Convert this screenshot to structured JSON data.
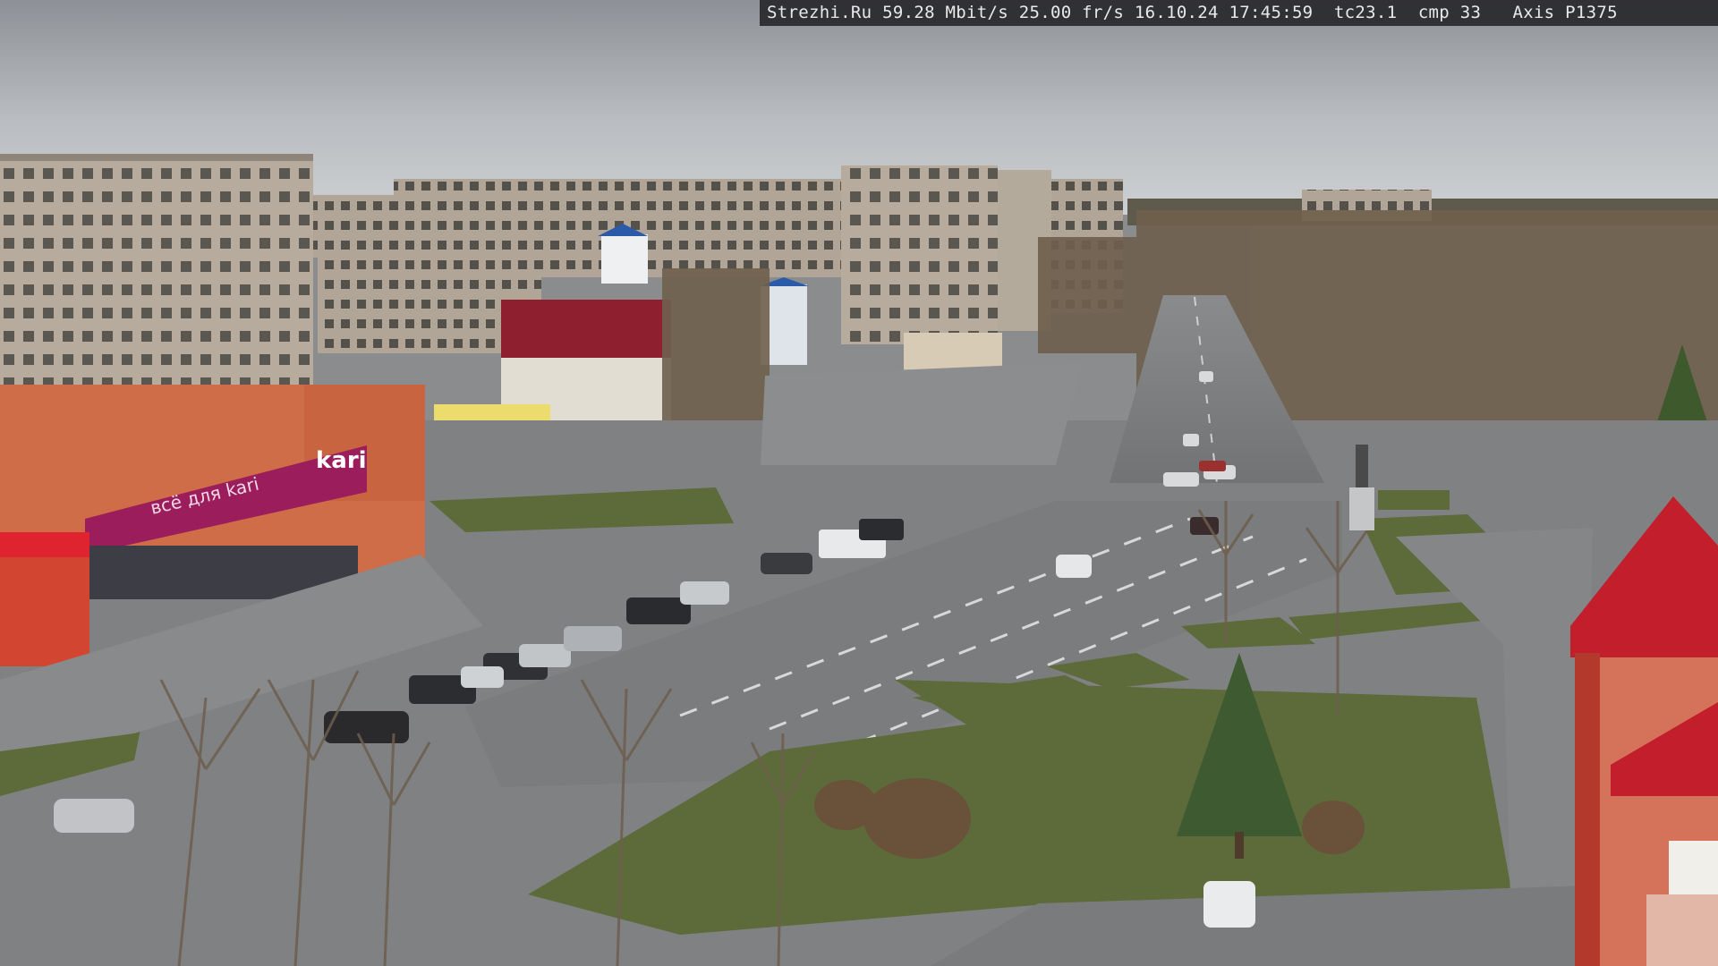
{
  "overlay": {
    "text": "Strezhi.Ru 59.28 Mbit/s 25.00 fr/s 16.10.24 17:45:59  tc23.1  cmp 33   Axis P1375"
  },
  "scene": {
    "store_sign": "kari",
    "store_banner": "всё для kari",
    "colors": {
      "sky": "#c3c6c9",
      "sky_top": "#9a9ea3",
      "asphalt": "#7d7e80",
      "grass": "#5a6538",
      "brick": "#cf6d48",
      "magenta": "#9b1d5c",
      "red_roof": "#c21e2c",
      "panel": "#b9aea0"
    }
  }
}
